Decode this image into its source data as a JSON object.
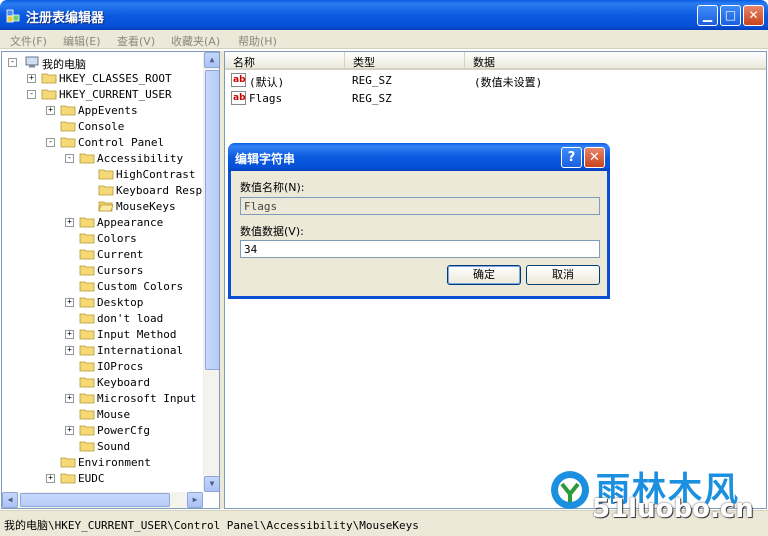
{
  "window": {
    "title": "注册表编辑器"
  },
  "menu": [
    "文件(F)",
    "编辑(E)",
    "查看(V)",
    "收藏夹(A)",
    "帮助(H)"
  ],
  "tree": {
    "root": "我的电脑",
    "items": [
      {
        "label": "HKEY_CLASSES_ROOT",
        "level": 1,
        "toggle": "+"
      },
      {
        "label": "HKEY_CURRENT_USER",
        "level": 1,
        "toggle": "-"
      },
      {
        "label": "AppEvents",
        "level": 2,
        "toggle": "+"
      },
      {
        "label": "Console",
        "level": 2,
        "toggle": ""
      },
      {
        "label": "Control Panel",
        "level": 2,
        "toggle": "-"
      },
      {
        "label": "Accessibility",
        "level": 3,
        "toggle": "-"
      },
      {
        "label": "HighContrast",
        "level": 4,
        "toggle": ""
      },
      {
        "label": "Keyboard Respo",
        "level": 4,
        "toggle": ""
      },
      {
        "label": "MouseKeys",
        "level": 4,
        "toggle": "",
        "open": true
      },
      {
        "label": "Appearance",
        "level": 3,
        "toggle": "+"
      },
      {
        "label": "Colors",
        "level": 3,
        "toggle": ""
      },
      {
        "label": "Current",
        "level": 3,
        "toggle": ""
      },
      {
        "label": "Cursors",
        "level": 3,
        "toggle": ""
      },
      {
        "label": "Custom Colors",
        "level": 3,
        "toggle": ""
      },
      {
        "label": "Desktop",
        "level": 3,
        "toggle": "+"
      },
      {
        "label": "don't load",
        "level": 3,
        "toggle": ""
      },
      {
        "label": "Input Method",
        "level": 3,
        "toggle": "+"
      },
      {
        "label": "International",
        "level": 3,
        "toggle": "+"
      },
      {
        "label": "IOProcs",
        "level": 3,
        "toggle": ""
      },
      {
        "label": "Keyboard",
        "level": 3,
        "toggle": ""
      },
      {
        "label": "Microsoft Input D",
        "level": 3,
        "toggle": "+"
      },
      {
        "label": "Mouse",
        "level": 3,
        "toggle": ""
      },
      {
        "label": "PowerCfg",
        "level": 3,
        "toggle": "+"
      },
      {
        "label": "Sound",
        "level": 3,
        "toggle": ""
      },
      {
        "label": "Environment",
        "level": 2,
        "toggle": ""
      },
      {
        "label": "EUDC",
        "level": 2,
        "toggle": "+"
      }
    ]
  },
  "list": {
    "headers": [
      "名称",
      "类型",
      "数据"
    ],
    "rows": [
      {
        "name": "(默认)",
        "type": "REG_SZ",
        "data": "(数值未设置)"
      },
      {
        "name": "Flags",
        "type": "REG_SZ",
        "data": ""
      }
    ]
  },
  "dialog": {
    "title": "编辑字符串",
    "help_label": "?",
    "close_label": "✕",
    "name_label": "数值名称(N):",
    "name_value": "Flags",
    "data_label": "数值数据(V):",
    "data_value": "34",
    "ok_label": "确定",
    "cancel_label": "取消"
  },
  "status": {
    "path": "我的电脑\\HKEY_CURRENT_USER\\Control Panel\\Accessibility\\MouseKeys"
  },
  "watermark": {
    "cn": "雨林木风",
    "en": "51luobo.cn"
  },
  "colors": {
    "titlebar": "#0a5ae0",
    "accent": "#1b8fe0",
    "close": "#c8431c"
  }
}
